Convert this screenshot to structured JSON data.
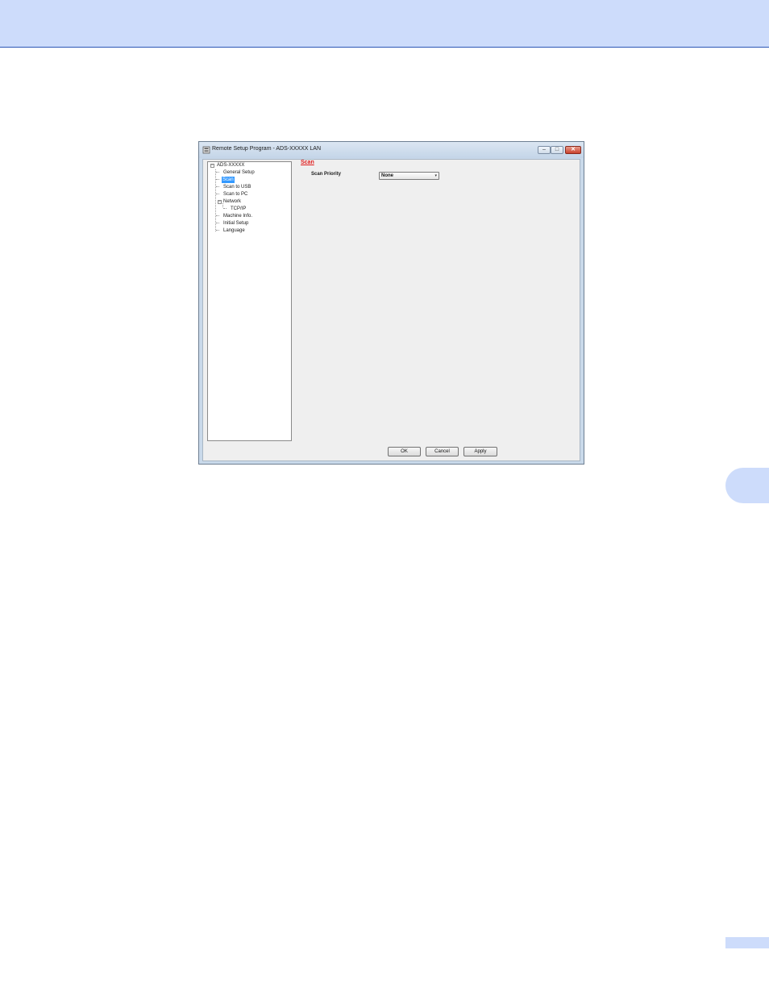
{
  "window": {
    "title": "Remote Setup Program - ADS-XXXXX LAN",
    "controls": {
      "minimize": "–",
      "maximize": "□",
      "close": "✕"
    }
  },
  "tree": {
    "root": "ADS-XXXXX",
    "items": {
      "general_setup": "General Setup",
      "scan": "Scan",
      "scan_to_usb": "Scan to USB",
      "scan_to_pc": "Scan to PC",
      "network": "Network",
      "tcp_ip": "TCP/IP",
      "machine_info": "Machine Info.",
      "initial_setup": "Initial Setup",
      "language": "Language"
    },
    "selected": "Scan",
    "expander_symbol": "−"
  },
  "panel": {
    "section_title": "Scan",
    "scan_priority_label": "Scan Priority",
    "scan_priority_value": "None",
    "dropdown_arrow": "▾"
  },
  "buttons": {
    "ok": "OK",
    "cancel": "Cancel",
    "apply": "Apply"
  },
  "colors": {
    "header_band": "#cddcfb",
    "section_title": "#e01a1a",
    "selection": "#3399ff"
  }
}
